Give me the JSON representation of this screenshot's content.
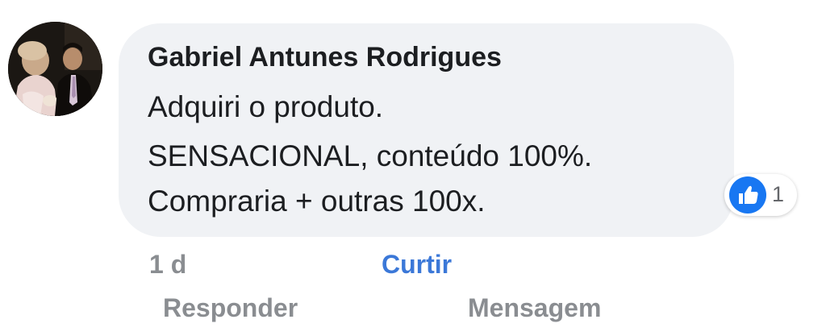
{
  "comment": {
    "author": "Gabriel Antunes Rodrigues",
    "lines": [
      "Adquiri o produto.",
      "SENSACIONAL, conteúdo 100%.",
      "Compraria + outras 100x."
    ],
    "reaction": {
      "icon": "thumbs-up-icon",
      "count": "1",
      "color": "#1877f2"
    }
  },
  "actions": {
    "time": "1 d",
    "like": "Curtir",
    "reply": "Responder",
    "message": "Mensagem"
  },
  "colors": {
    "bubble": "#f0f2f5",
    "like_link": "#3b78d8",
    "muted": "#8a8d91",
    "text": "#1c1e21"
  }
}
